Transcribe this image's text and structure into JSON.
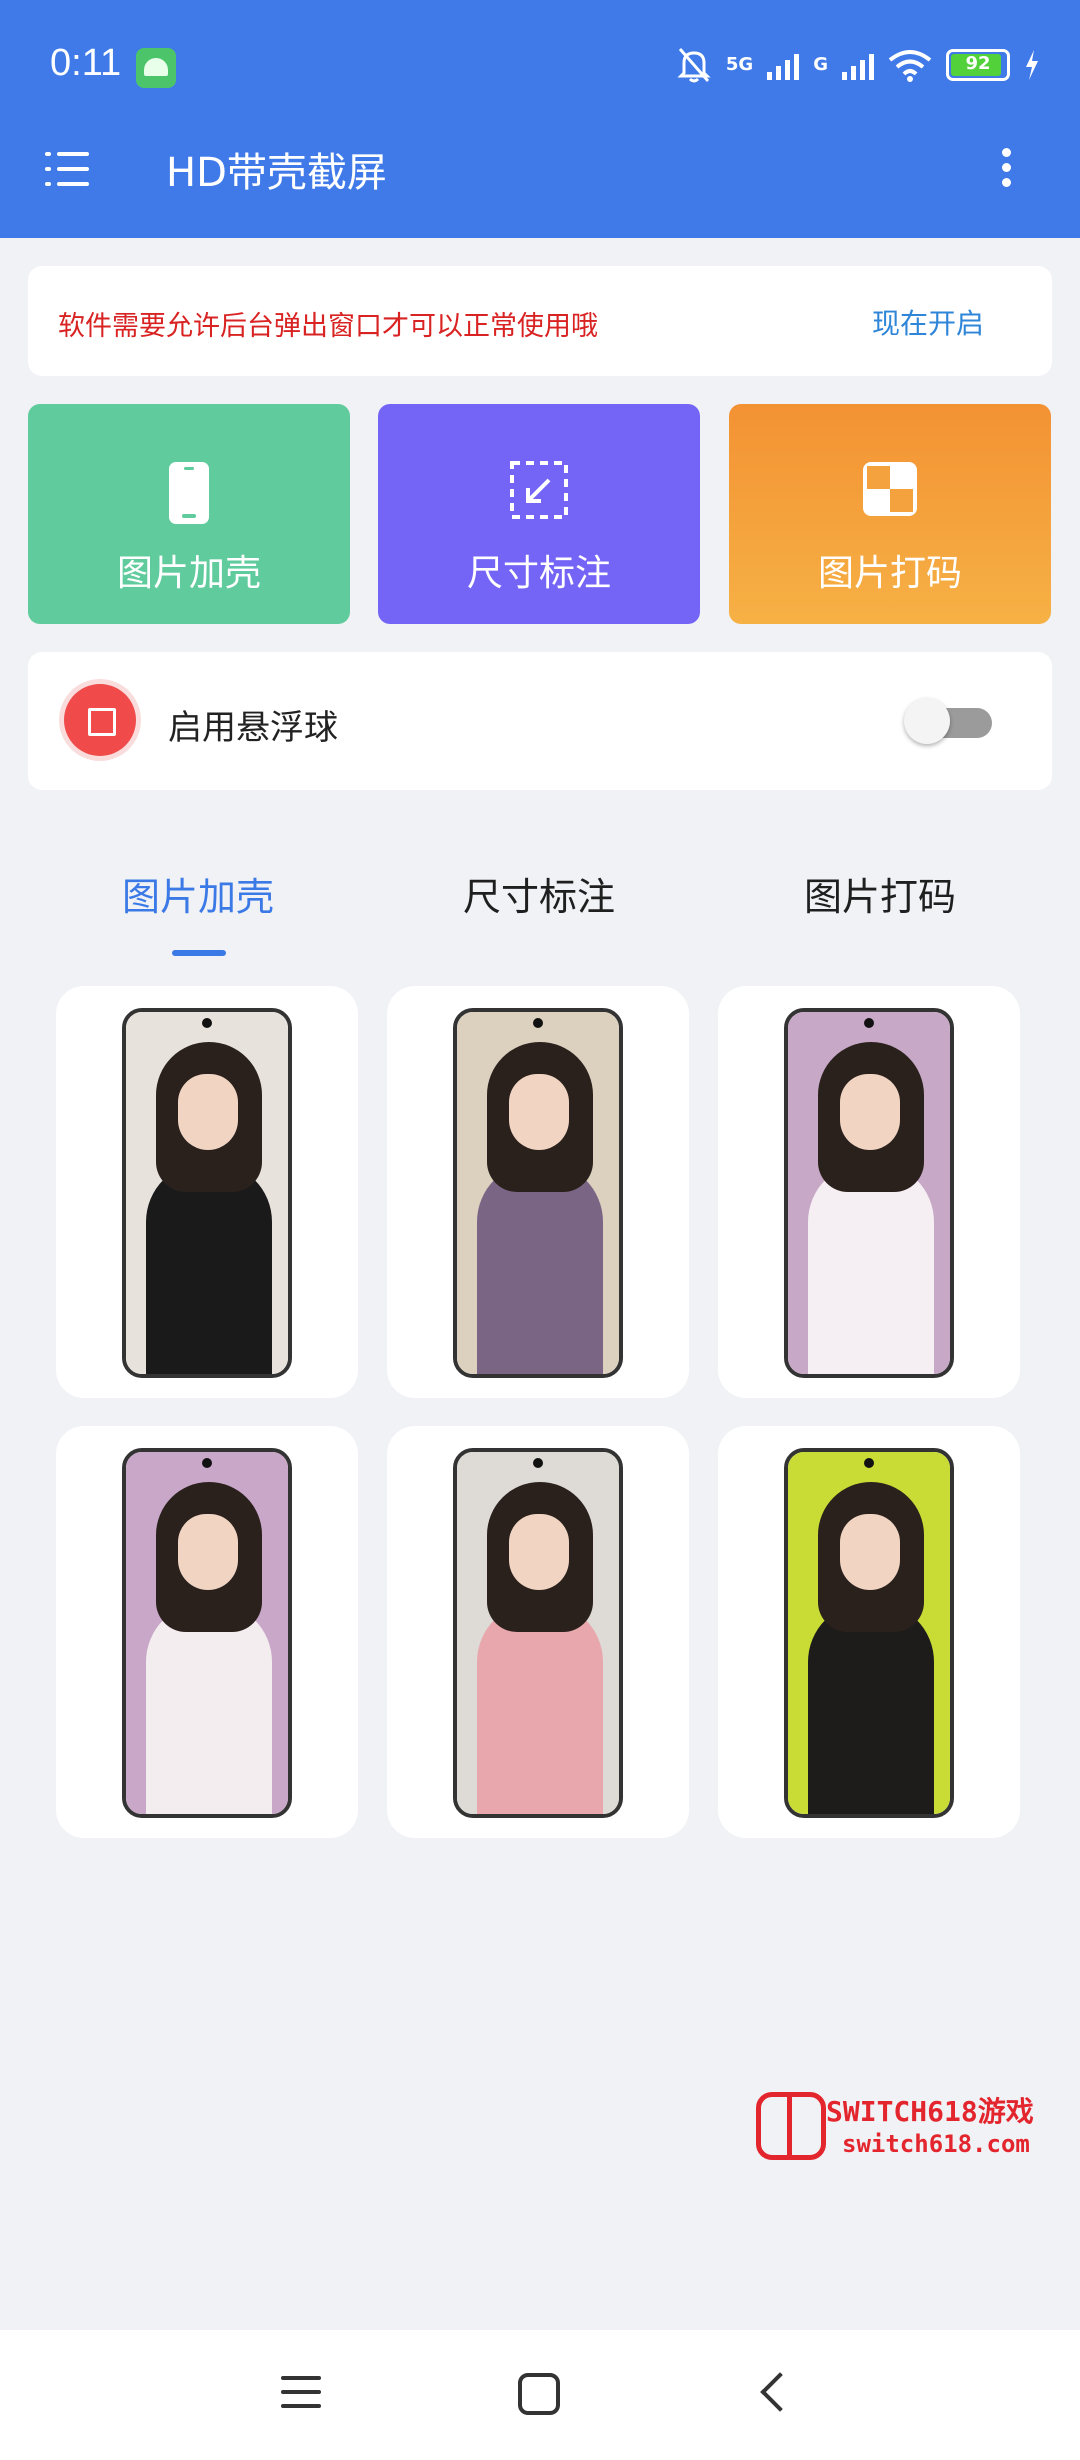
{
  "status": {
    "time": "0:11",
    "network_1": "5G",
    "network_2": "G",
    "battery": "92",
    "battery_level": 0.92
  },
  "toolbar": {
    "title": "HD带壳截屏"
  },
  "notice": {
    "text": "软件需要允许后台弹出窗口才可以正常使用哦",
    "button": "现在开启"
  },
  "tools": [
    {
      "label": "图片加壳",
      "icon": "phone-icon",
      "color": "#60cb9c"
    },
    {
      "label": "尺寸标注",
      "icon": "resize-icon",
      "color": "#7565f6"
    },
    {
      "label": "图片打码",
      "icon": "mosaic-icon",
      "color": "#f3a03b"
    }
  ],
  "floating_ball": {
    "label": "启用悬浮球",
    "enabled": false
  },
  "tabs": [
    {
      "label": "图片加壳",
      "active": true
    },
    {
      "label": "尺寸标注",
      "active": false
    },
    {
      "label": "图片打码",
      "active": false
    }
  ],
  "gallery": [
    {
      "name": "gallery-item-1",
      "bg": "#e8e2dc",
      "outfit": "#1a1a1a"
    },
    {
      "name": "gallery-item-2",
      "bg": "#dcd0bf",
      "outfit": "#7b6585"
    },
    {
      "name": "gallery-item-3",
      "bg": "#c7a8c6",
      "outfit": "#f5eef2"
    },
    {
      "name": "gallery-item-4",
      "bg": "#c9a7c8",
      "outfit": "#f4edf0"
    },
    {
      "name": "gallery-item-5",
      "bg": "#dedbd6",
      "outfit": "#e8a7ad"
    },
    {
      "name": "gallery-item-6",
      "bg": "#c8dc35",
      "outfit": "#1d1c1a"
    }
  ],
  "watermark": {
    "line1": "SWITCH618游戏",
    "line2": "switch618.com"
  },
  "colors": {
    "primary": "#3f7ae8",
    "accent_tab": "#3b7ae6",
    "warning_text": "#d92323",
    "link": "#2f86d8"
  }
}
